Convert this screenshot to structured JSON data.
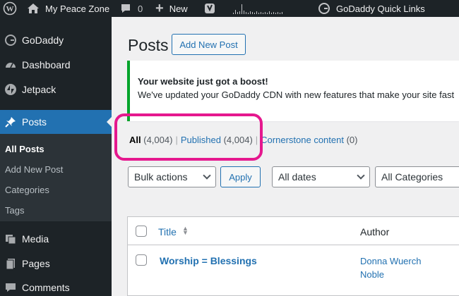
{
  "adminbar": {
    "site_name": "My Peace Zone",
    "comments_count": "0",
    "new_label": "New",
    "quick_links_label": "GoDaddy Quick Links"
  },
  "sidebar": {
    "items": [
      {
        "label": "GoDaddy",
        "icon": "godaddy-icon"
      },
      {
        "label": "Dashboard",
        "icon": "dashboard-icon"
      },
      {
        "label": "Jetpack",
        "icon": "jetpack-icon"
      },
      {
        "label": "Posts",
        "icon": "pin-icon"
      },
      {
        "label": "Media",
        "icon": "media-icon"
      },
      {
        "label": "Pages",
        "icon": "pages-icon"
      },
      {
        "label": "Comments",
        "icon": "comment-icon"
      }
    ],
    "submenu": [
      "All Posts",
      "Add New Post",
      "Categories",
      "Tags"
    ]
  },
  "main": {
    "title": "Posts",
    "add_new_label": "Add New Post",
    "notice": {
      "title": "Your website just got a boost!",
      "text": "We've updated your GoDaddy CDN with new features that make your site fast"
    },
    "filters": {
      "all_label": "All",
      "all_count": "(4,004)",
      "published_label": "Published",
      "published_count": "(4,004)",
      "cornerstone_label": "Cornerstone content",
      "cornerstone_count": "(0)"
    },
    "bulk_actions": "Bulk actions",
    "apply_label": "Apply",
    "dates_filter": "All dates",
    "categories_filter": "All Categories",
    "table": {
      "col_title": "Title",
      "col_author": "Author",
      "rows": [
        {
          "title": "Worship = Blessings",
          "author": "Donna Wuerch Noble"
        }
      ]
    }
  },
  "colors": {
    "adminbar_bg": "#1d2327",
    "accent": "#2271b1",
    "notice_border": "#00a32a",
    "highlight": "#e5188e"
  }
}
